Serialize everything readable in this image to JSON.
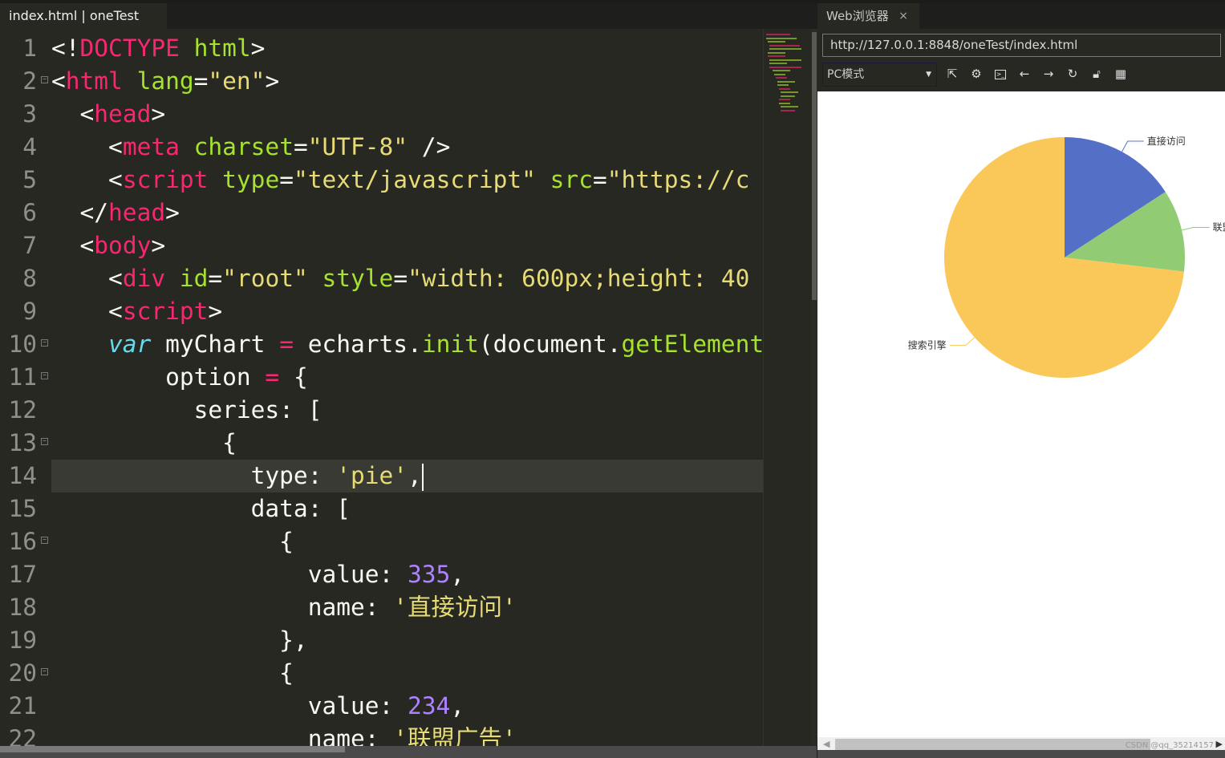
{
  "editor": {
    "tab_label": "index.html | oneTest",
    "current_line": 14,
    "lines": [
      {
        "n": "1",
        "fold": false,
        "t": [
          [
            "",
            "<!"
          ],
          [
            "t-tag",
            "DOCTYPE"
          ],
          [
            "",
            " "
          ],
          [
            "t-attr",
            "html"
          ],
          [
            "",
            ">"
          ]
        ]
      },
      {
        "n": "2",
        "fold": true,
        "t": [
          [
            "",
            "<"
          ],
          [
            "t-tag",
            "html"
          ],
          [
            "",
            " "
          ],
          [
            "t-attr",
            "lang"
          ],
          [
            "",
            "="
          ],
          [
            "t-str",
            "\"en\""
          ],
          [
            "",
            ">"
          ]
        ]
      },
      {
        "n": "3",
        "fold": false,
        "t": [
          [
            "",
            "  <"
          ],
          [
            "t-tag",
            "head"
          ],
          [
            "",
            ">"
          ]
        ]
      },
      {
        "n": "4",
        "fold": false,
        "t": [
          [
            "",
            "    <"
          ],
          [
            "t-tag",
            "meta"
          ],
          [
            "",
            " "
          ],
          [
            "t-attr",
            "charset"
          ],
          [
            "",
            "="
          ],
          [
            "t-str",
            "\"UTF-8\""
          ],
          [
            "",
            " />"
          ]
        ]
      },
      {
        "n": "5",
        "fold": false,
        "t": [
          [
            "",
            "    <"
          ],
          [
            "t-tag",
            "script"
          ],
          [
            "",
            " "
          ],
          [
            "t-attr",
            "type"
          ],
          [
            "",
            "="
          ],
          [
            "t-str",
            "\"text/javascript\""
          ],
          [
            "",
            " "
          ],
          [
            "t-attr",
            "src"
          ],
          [
            "",
            "="
          ],
          [
            "t-str",
            "\"https://c"
          ]
        ]
      },
      {
        "n": "6",
        "fold": false,
        "t": [
          [
            "",
            "  </"
          ],
          [
            "t-tag",
            "head"
          ],
          [
            "",
            ">"
          ]
        ]
      },
      {
        "n": "7",
        "fold": false,
        "t": [
          [
            "",
            "  <"
          ],
          [
            "t-tag",
            "body"
          ],
          [
            "",
            ">"
          ]
        ]
      },
      {
        "n": "8",
        "fold": false,
        "t": [
          [
            "",
            "    <"
          ],
          [
            "t-tag",
            "div"
          ],
          [
            "",
            " "
          ],
          [
            "t-attr",
            "id"
          ],
          [
            "",
            "="
          ],
          [
            "t-str",
            "\"root\""
          ],
          [
            "",
            " "
          ],
          [
            "t-attr",
            "style"
          ],
          [
            "",
            "="
          ],
          [
            "t-str",
            "\"width: 600px;height: 40"
          ]
        ]
      },
      {
        "n": "9",
        "fold": false,
        "t": [
          [
            "",
            "    <"
          ],
          [
            "t-tag",
            "script"
          ],
          [
            "",
            ">"
          ]
        ]
      },
      {
        "n": "10",
        "fold": true,
        "t": [
          [
            "",
            "    "
          ],
          [
            "t-kw",
            "var"
          ],
          [
            "",
            " myChart "
          ],
          [
            "t-op",
            "="
          ],
          [
            "",
            " echarts."
          ],
          [
            "t-fn",
            "init"
          ],
          [
            "",
            "(document."
          ],
          [
            "t-fn",
            "getElement"
          ]
        ]
      },
      {
        "n": "11",
        "fold": true,
        "t": [
          [
            "",
            "        option "
          ],
          [
            "t-op",
            "="
          ],
          [
            "",
            " {"
          ]
        ]
      },
      {
        "n": "12",
        "fold": false,
        "t": [
          [
            "",
            "          series: ["
          ]
        ]
      },
      {
        "n": "13",
        "fold": true,
        "t": [
          [
            "",
            "            {"
          ]
        ]
      },
      {
        "n": "14",
        "fold": false,
        "t": [
          [
            "",
            "              type: "
          ],
          [
            "t-str",
            "'pie'"
          ],
          [
            "",
            ","
          ]
        ]
      },
      {
        "n": "15",
        "fold": false,
        "t": [
          [
            "",
            "              data: ["
          ]
        ]
      },
      {
        "n": "16",
        "fold": true,
        "t": [
          [
            "",
            "                {"
          ]
        ]
      },
      {
        "n": "17",
        "fold": false,
        "t": [
          [
            "",
            "                  value: "
          ],
          [
            "t-num",
            "335"
          ],
          [
            "",
            ","
          ]
        ]
      },
      {
        "n": "18",
        "fold": false,
        "t": [
          [
            "",
            "                  name: "
          ],
          [
            "t-str",
            "'直接访问'"
          ]
        ]
      },
      {
        "n": "19",
        "fold": false,
        "t": [
          [
            "",
            "                },"
          ]
        ]
      },
      {
        "n": "20",
        "fold": true,
        "t": [
          [
            "",
            "                {"
          ]
        ]
      },
      {
        "n": "21",
        "fold": false,
        "t": [
          [
            "",
            "                  value: "
          ],
          [
            "t-num",
            "234"
          ],
          [
            "",
            ","
          ]
        ]
      },
      {
        "n": "22",
        "fold": false,
        "t": [
          [
            "",
            "                  name: "
          ],
          [
            "t-str",
            "'联盟广告'"
          ]
        ]
      }
    ]
  },
  "browser": {
    "tab_label": "Web浏览器",
    "close_glyph": "×",
    "url": "http://127.0.0.1:8848/oneTest/index.html",
    "mode": "PC模式",
    "tools": [
      "popout-icon",
      "settings-icon",
      "console-icon",
      "back-icon",
      "forward-icon",
      "reload-icon",
      "lock-icon",
      "qrcode-icon"
    ],
    "watermark": "CSDN @qq_35214157"
  },
  "chart_data": {
    "type": "pie",
    "categories": [
      "直接访问",
      "联盟广告",
      "搜索引擎"
    ],
    "values": [
      335,
      234,
      1548
    ],
    "colors": [
      "#5470c6",
      "#91cc75",
      "#fac858"
    ],
    "start_angle_deg": 90,
    "clockwise": true
  }
}
